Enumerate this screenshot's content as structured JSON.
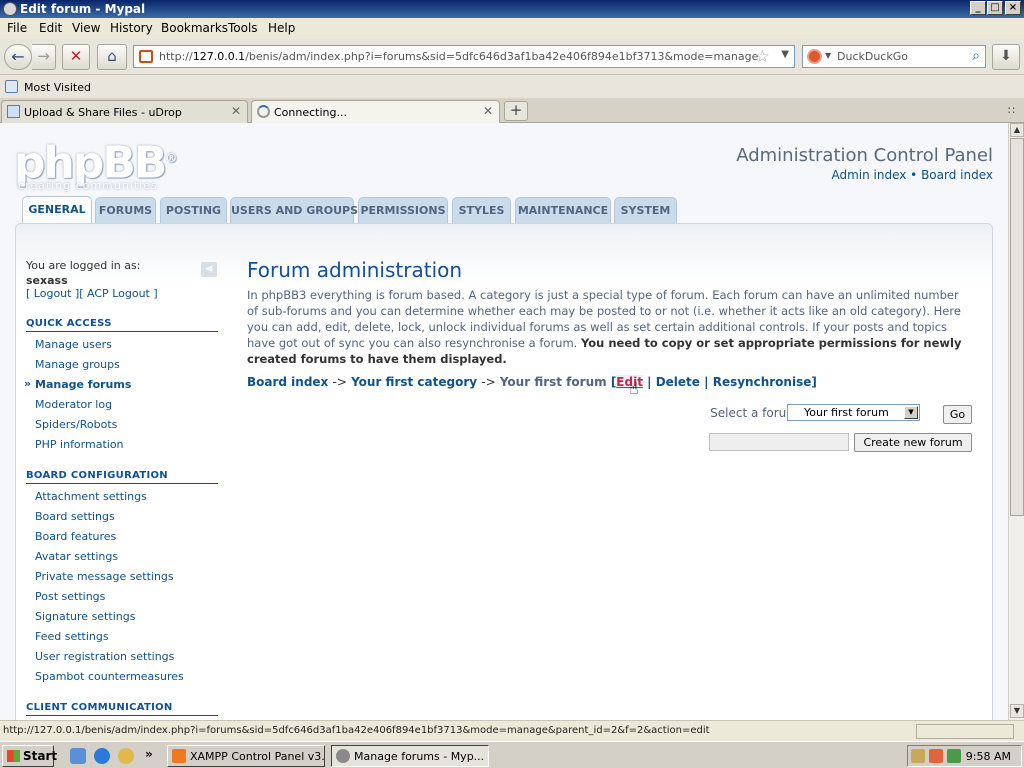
{
  "window": {
    "title": "Edit forum - Mypal",
    "controls": {
      "minimize": "_",
      "maximize": "□",
      "close": "×"
    }
  },
  "menubar": {
    "items": [
      "File",
      "Edit",
      "View",
      "History",
      "Bookmarks",
      "Tools",
      "Help"
    ]
  },
  "toolbar": {
    "url_prefix": "http://",
    "url_host": "127.0.0.1",
    "url_rest": "/benis/adm/index.php?i=forums&sid=5dfc646d3af1ba42e406f894e1bf3713&mode=manage",
    "search_placeholder": "DuckDuckGo"
  },
  "bookmarks": {
    "items": [
      "Most Visited"
    ]
  },
  "tabs": [
    {
      "label": "Upload & Share Files - uDrop",
      "icon": "udrop-icon"
    },
    {
      "label": "Connecting...",
      "icon": "loading-spinner-icon"
    }
  ],
  "page": {
    "logo_text": "phpBB",
    "logo_mark": "®",
    "logo_sub": "creating    communities",
    "acp_title": "Administration Control Panel",
    "acp_admin_index": "Admin index",
    "acp_bullet": "•",
    "acp_board_index": "Board index",
    "nav_tabs": [
      "GENERAL",
      "FORUMS",
      "POSTING",
      "USERS AND GROUPS",
      "PERMISSIONS",
      "STYLES",
      "MAINTENANCE",
      "SYSTEM"
    ],
    "active_tab": "GENERAL",
    "sidebar": {
      "logged_in_label": "You are logged in as:",
      "username": "sexass",
      "logout": "Logout",
      "acp_logout": "ACP Logout",
      "groups": [
        {
          "heading": "QUICK ACCESS",
          "items": [
            "Manage users",
            "Manage groups",
            "Manage forums",
            "Moderator log",
            "Spiders/Robots",
            "PHP information"
          ],
          "current": "Manage forums"
        },
        {
          "heading": "BOARD CONFIGURATION",
          "items": [
            "Attachment settings",
            "Board settings",
            "Board features",
            "Avatar settings",
            "Private message settings",
            "Post settings",
            "Signature settings",
            "Feed settings",
            "User registration settings",
            "Spambot countermeasures"
          ]
        },
        {
          "heading": "CLIENT COMMUNICATION",
          "items": []
        }
      ]
    },
    "content": {
      "title": "Forum administration",
      "description": "In phpBB3 everything is forum based. A category is just a special type of forum. Each forum can have an unlimited number of sub-forums and you can determine whether each may be posted to or not (i.e. whether it acts like an old category). Here you can add, edit, delete, lock, unlock individual forums as well as set certain additional controls. If your posts and topics have got out of sync you can also resynchronise a forum.",
      "description_bold": "You need to copy or set appropriate permissions for newly created forums to have them displayed.",
      "breadcrumb": {
        "board_index": "Board index",
        "arrow": "->",
        "category": "Your first category",
        "forum": "Your first forum",
        "open": "[",
        "edit": "Edit",
        "pipe": "|",
        "delete": "Delete",
        "resync": "Resynchronise",
        "close": "]"
      },
      "select_label": "Select a forum:",
      "select_value": "Your first forum",
      "go_button": "Go",
      "new_forum_value": "",
      "create_button": "Create new forum"
    }
  },
  "statusbar": {
    "text": "http://127.0.0.1/benis/adm/index.php?i=forums&sid=5dfc646d3af1ba42e406f894e1bf3713&mode=manage&parent_id=2&f=2&action=edit"
  },
  "taskbar": {
    "start_label": "Start",
    "overflow": "»",
    "tasks": [
      {
        "label": "XAMPP Control Panel v3....",
        "active": false
      },
      {
        "label": "Manage forums - Myp...",
        "active": true
      }
    ],
    "clock": "9:58 AM"
  },
  "colors": {
    "link": "#105289",
    "heading": "#115098",
    "active_action": "#bc2a4d",
    "tab_bg": "#cadceb"
  }
}
